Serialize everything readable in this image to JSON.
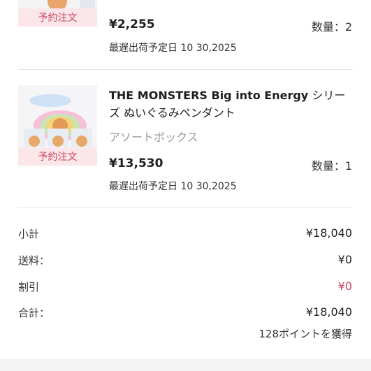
{
  "items": [
    {
      "badge": "予約注文",
      "price": "¥2,255",
      "quantity": "数量：2",
      "ship_date": "最遅出荷予定日 10 30,2025"
    },
    {
      "badge": "予約注文",
      "title_main": "THE MONSTERS Big into Energy",
      "title_rest": " シリーズ ぬいぐるみペンダント",
      "variant": "アソートボックス",
      "price": "¥13,530",
      "quantity": "数量：1",
      "ship_date": "最遅出荷予定日 10 30,2025"
    }
  ],
  "summary": {
    "subtotal_label": "小計",
    "subtotal_value": "¥18,040",
    "shipping_label": "送料：",
    "shipping_value": "¥0",
    "discount_label": "割引",
    "discount_value": "¥0",
    "total_label": "合計：",
    "total_value": "¥18,040",
    "points": "128ポイントを獲得"
  },
  "colors": {
    "accent_red": "#c8475f",
    "badge_bg": "#fbe6ea"
  }
}
